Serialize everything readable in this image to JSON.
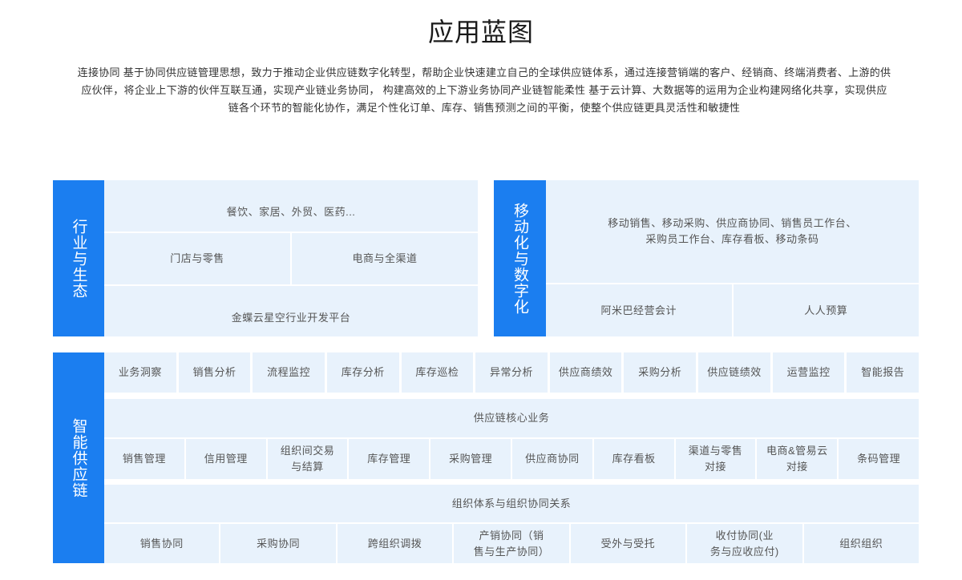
{
  "page": {
    "title": "应用蓝图",
    "description": "连接协同 基于协同供应链管理思想，致力于推动企业供应链数字化转型，帮助企业快速建立自己的全球供应链体系，通过连接营销端的客户、经销商、终端消费者、上游的供应伙伴，将企业上下游的伙伴互联互通，实现产业链业务协同， 构建高效的上下游业务协同产业链智能柔性 基于云计算、大数据等的运用为企业构建网络化共享，实现供应链各个环节的智能化协作，满足个性化订单、库存、销售预测之间的平衡，使整个供应链更具灵活性和敏捷性"
  },
  "theme": {
    "accent": "#1b7ef0",
    "cell_bg": "#e8f2fc",
    "cell_text": "#555555"
  },
  "industry": {
    "header": "行业与生态",
    "row1": "餐饮、家居、外贸、医药...",
    "row2": [
      "门店与零售",
      "电商与全渠道"
    ],
    "row3": "金蝶云星空行业开发平台"
  },
  "mobile": {
    "header": "移动化与数字化",
    "row1": "移动销售、移动采购、供应商协同、销售员工作台、\n采购员工作台、库存看板、移动条码",
    "row2": [
      "阿米巴经营会计",
      "人人预算"
    ]
  },
  "supply_chain": {
    "header": "智能供应链",
    "analytics": [
      "业务洞察",
      "销售分析",
      "流程监控",
      "库存分析",
      "库存巡检",
      "异常分析",
      "供应商绩效",
      "采购分析",
      "供应链绩效",
      "运营监控",
      "智能报告"
    ],
    "core_title": "供应链核心业务",
    "core_items": [
      "销售管理",
      "信用管理",
      "组织间交易\n与结算",
      "库存管理",
      "采购管理",
      "供应商协同",
      "库存看板",
      "渠道与零售\n对接",
      "电商&管易云\n对接",
      "条码管理"
    ],
    "org_title": "组织体系与组织协同关系",
    "org_items": [
      "销售协同",
      "采购协同",
      "跨组织调拨",
      "产销协同（销\n售与生产协同）",
      "受外与受托",
      "收付协同(业\n务与应收应付)",
      "组织组织"
    ]
  }
}
